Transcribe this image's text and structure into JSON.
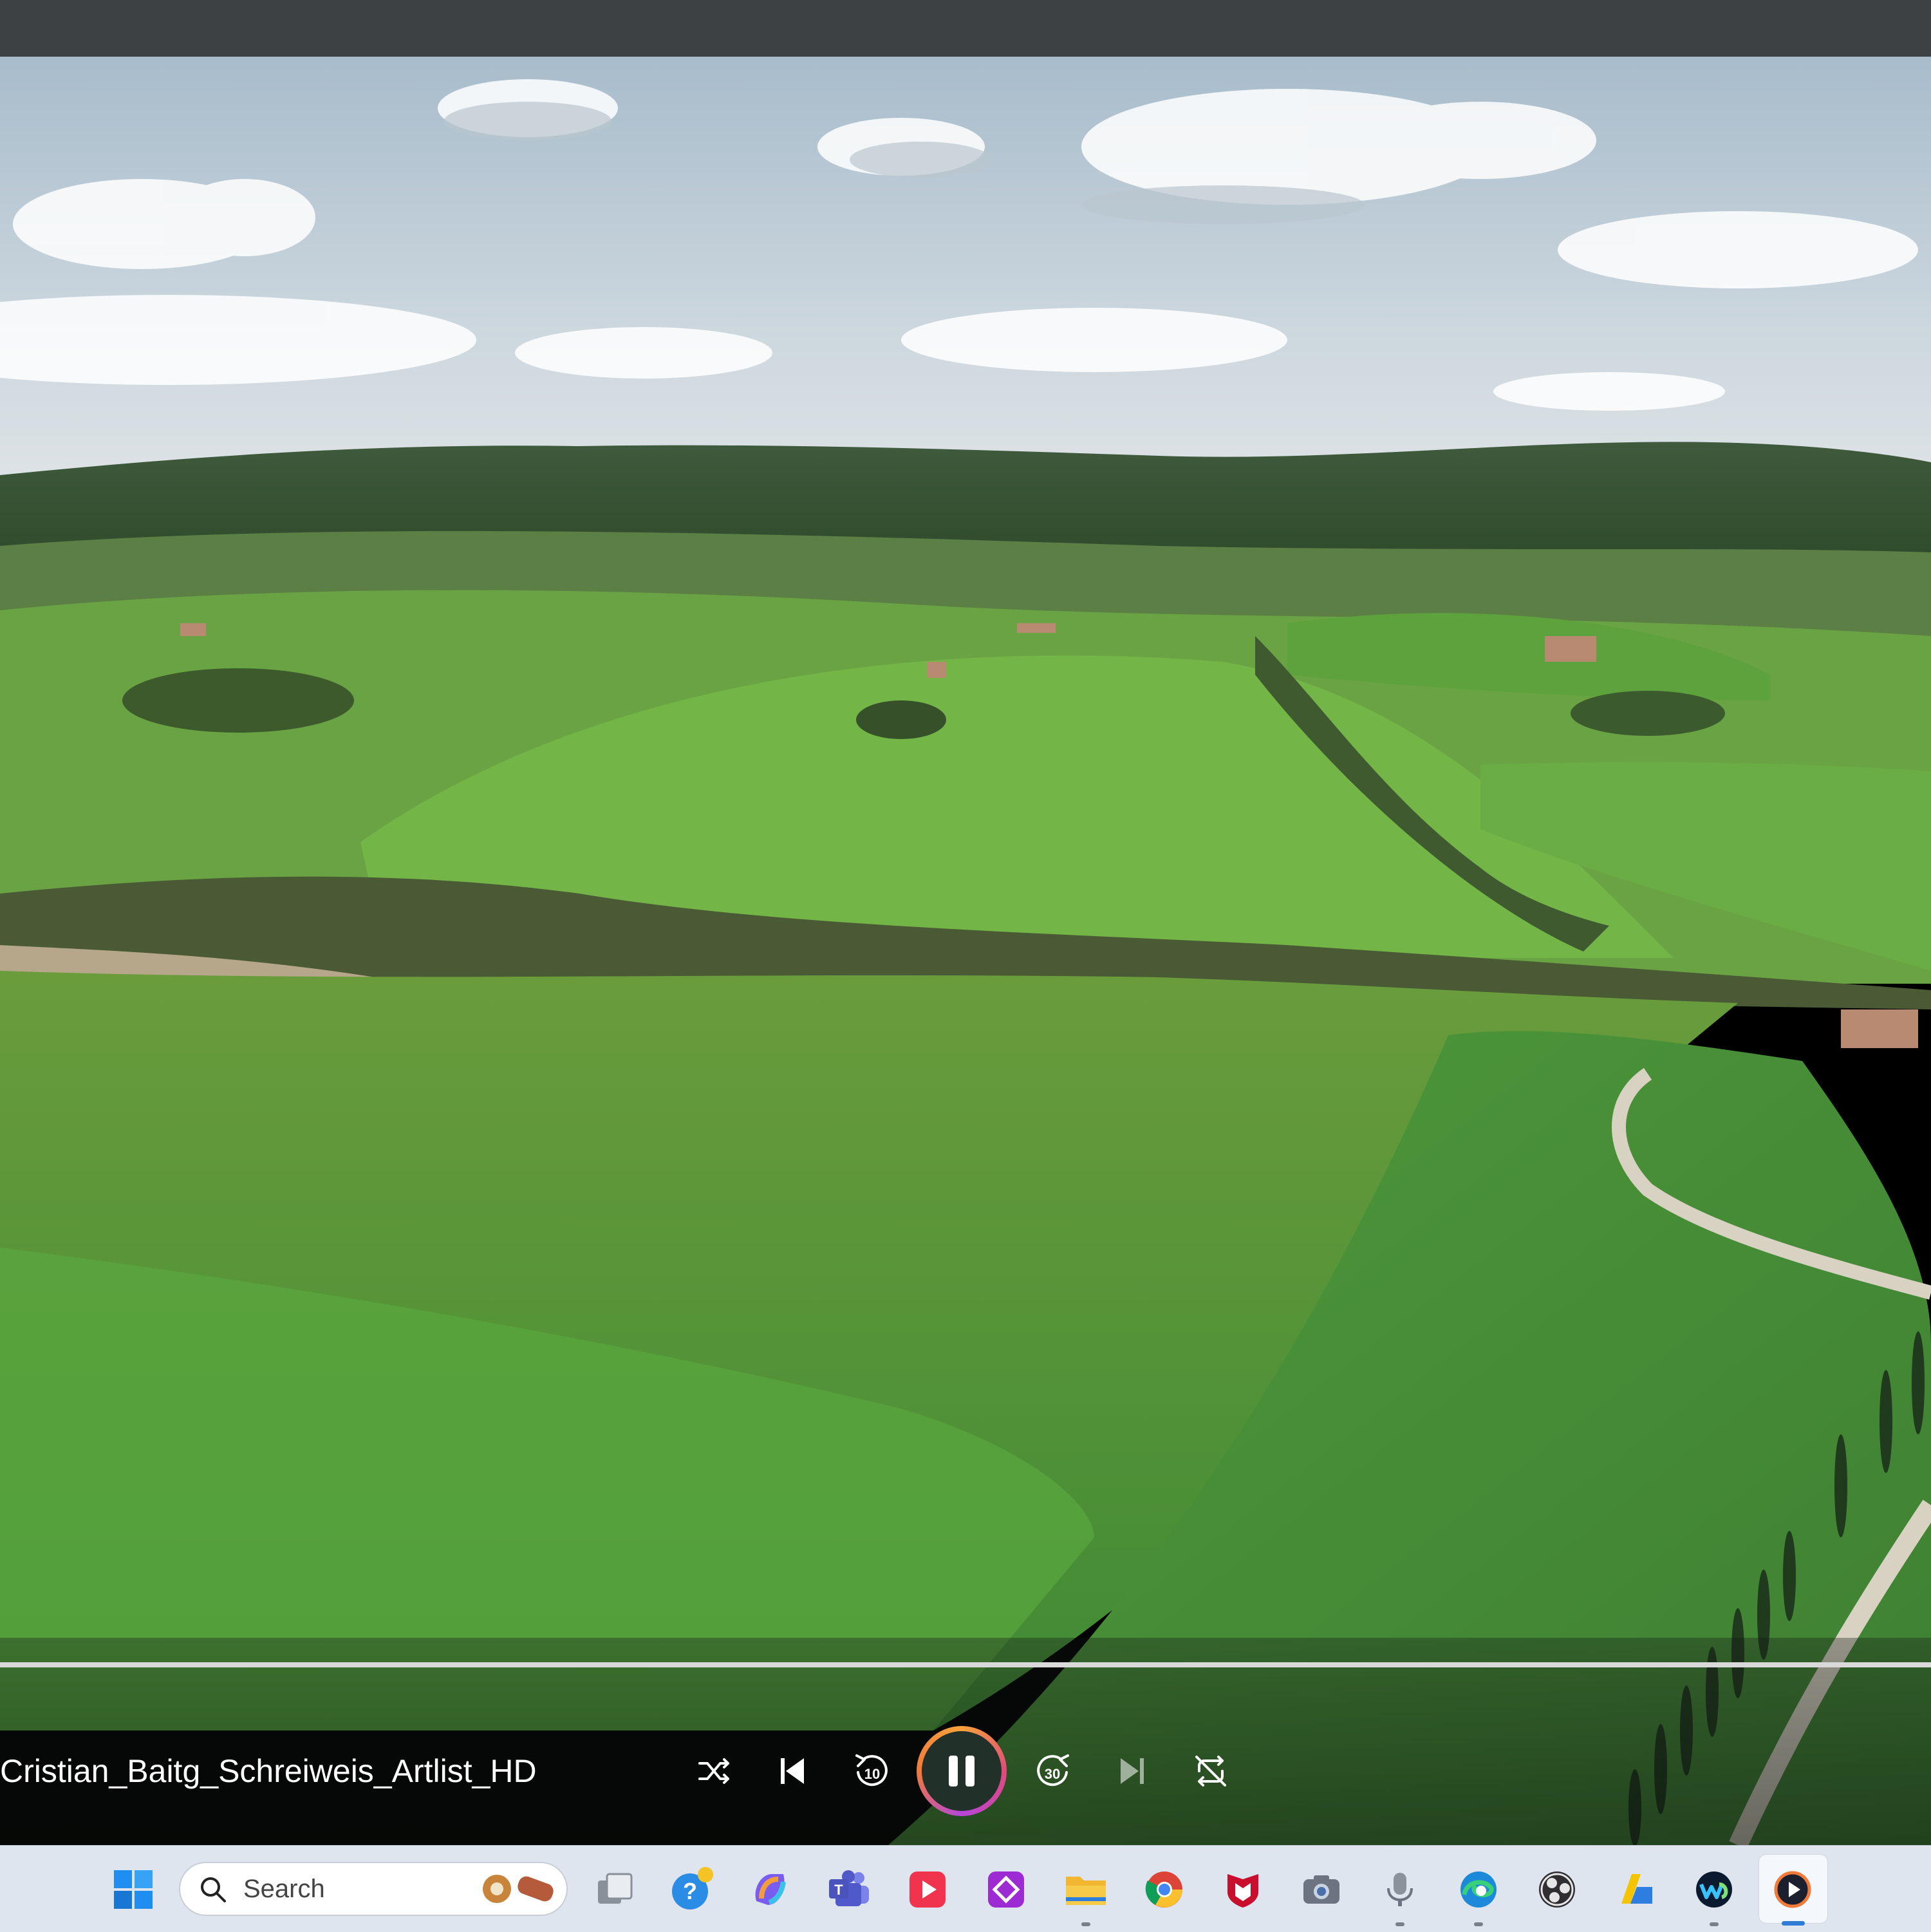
{
  "player": {
    "video_title": "Cristian_Baitg_Schreiweis_Artlist_HD",
    "progress": 1.0,
    "controls": [
      "shuffle",
      "previous",
      "rewind 10",
      "pause",
      "forward 30",
      "next",
      "repeat off"
    ],
    "skip_back_seconds": "10",
    "skip_forward_seconds": "30"
  },
  "taskbar": {
    "search_placeholder": "Search",
    "apps": [
      "start",
      "search",
      "task-view",
      "get-help",
      "copilot",
      "teams",
      "media-player-red",
      "power-apps",
      "file-explorer",
      "chrome",
      "mcafee",
      "camera",
      "voice-recorder",
      "edge",
      "obs-studio",
      "sticky-files",
      "webex",
      "media-player"
    ]
  }
}
